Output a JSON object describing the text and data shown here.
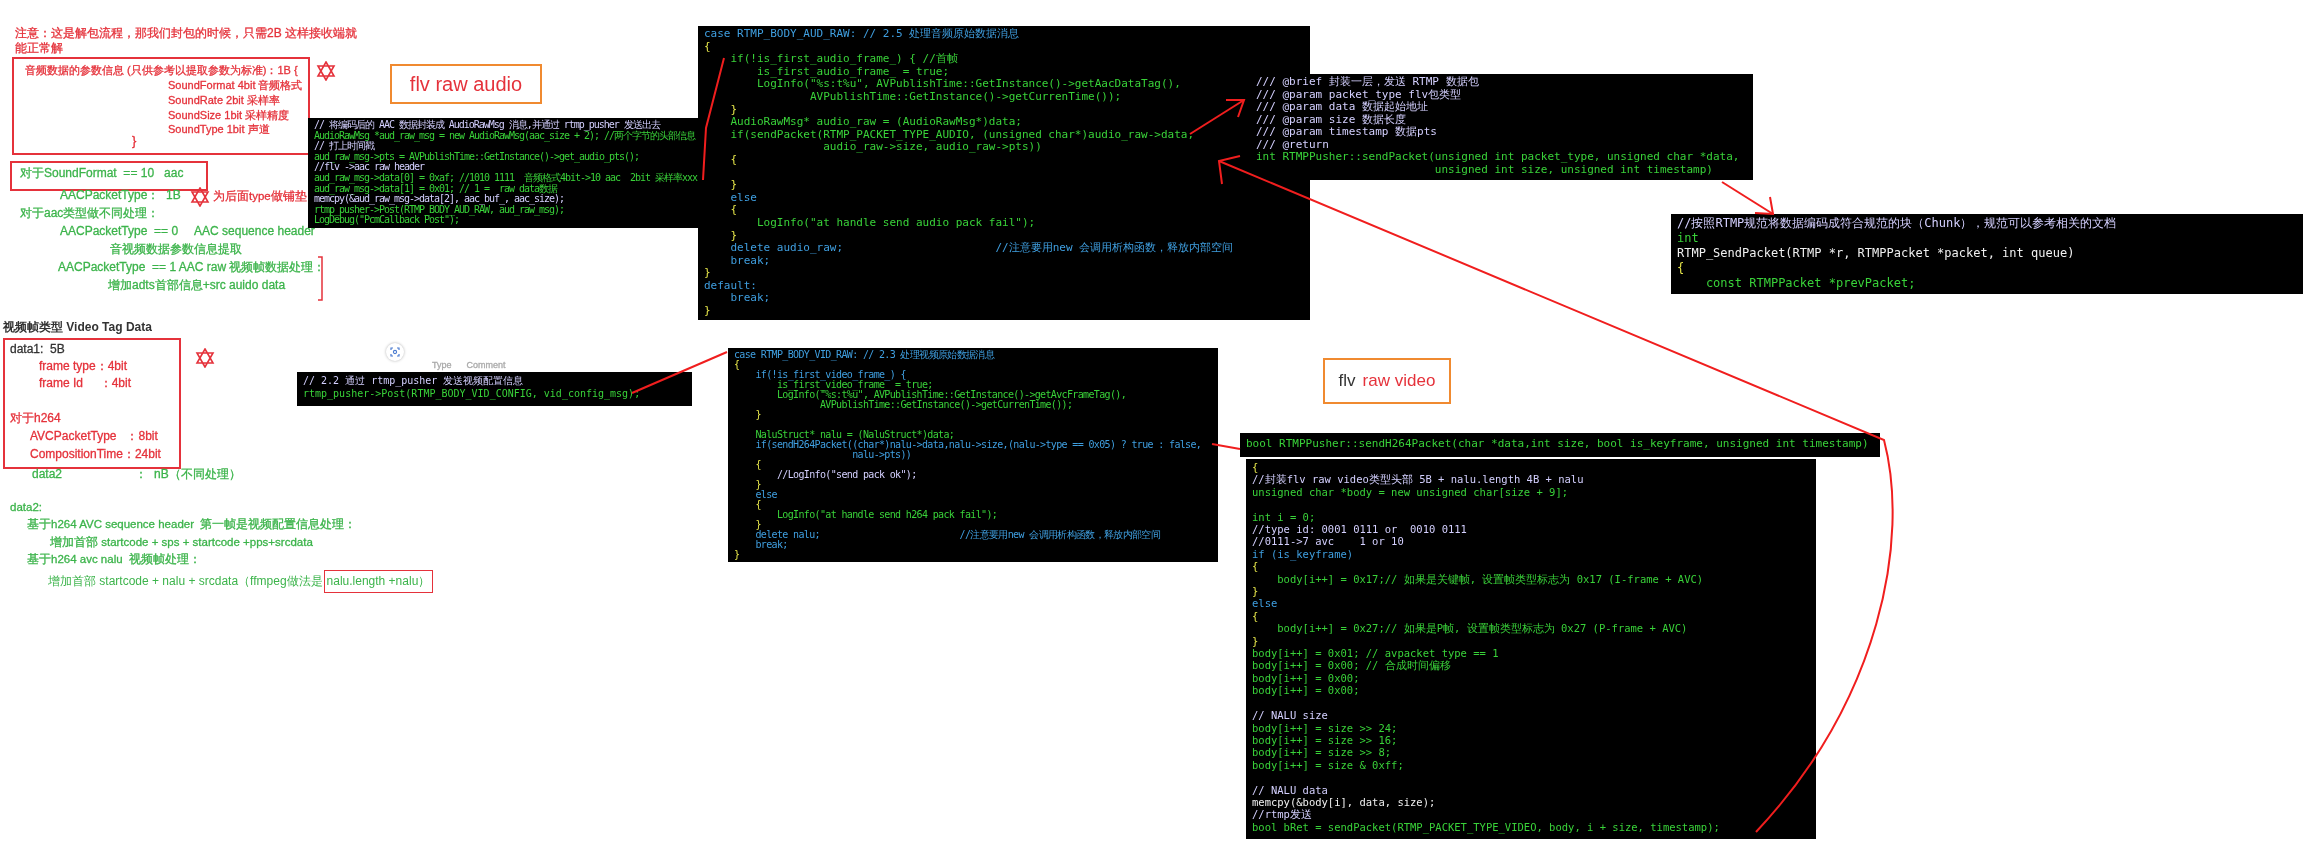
{
  "notes": [
    {
      "text": "注意：这是解包流程，那我们封包的时候，只需2B 这样接收端就能正常解",
      "color": "#e5323b"
    },
    {
      "text": "音频数据的参数信息 (只供参考以提取参数为标准)：1B {",
      "color": "#e5323b"
    },
    {
      "text": "SoundFormat 4bit 音频格式",
      "color": "#e5323b"
    },
    {
      "text": "SoundRate 2bit 采样率",
      "color": "#e5323b"
    },
    {
      "text": "SoundSize 1bit 采样精度",
      "color": "#e5323b"
    },
    {
      "text": "SoundType 1bit 声道",
      "color": "#e5323b"
    },
    {
      "text": "}",
      "color": "#e5323b"
    },
    {
      "text": "对于SoundFormat  == 10   aac",
      "color": "#3cb44b"
    },
    {
      "text": "AACPacketType：  1B",
      "color": "#3cb44b"
    },
    {
      "text": "为后面type做铺垫",
      "color": "#e5323b"
    },
    {
      "text": "对于aac类型做不同处理：",
      "color": "#3cb44b"
    },
    {
      "text": "AACPacketType  == 0     AAC sequence header",
      "color": "#3cb44b"
    },
    {
      "text": "音视频数据参数信息提取",
      "color": "#3cb44b"
    },
    {
      "text": "AACPacketType  == 1 AAC raw 视频帧数据处理：",
      "color": "#3cb44b"
    },
    {
      "text": "增加adts首部信息+src auido data",
      "color": "#3cb44b"
    },
    {
      "text": "data1:  5B",
      "color": "#333333"
    },
    {
      "text": "frame type：4bit",
      "color": "#e5323b"
    },
    {
      "text": "frame Id     ：4bit",
      "color": "#e5323b"
    },
    {
      "text": "对于h264",
      "color": "#e5323b"
    },
    {
      "text": "AVCPacketType   ：8bit",
      "color": "#e5323b"
    },
    {
      "text": "CompositionTime：24bit",
      "color": "#e5323b"
    },
    {
      "text": "data2                      ：  nB（不同处理）",
      "color": "#3cb44b"
    },
    {
      "text": "data2:",
      "color": "#3cb44b"
    },
    {
      "text": "基于h264 AVC sequence header  第一帧是视频配置信息处理：",
      "color": "#3cb44b"
    },
    {
      "text": "增加首部 startcode + sps + startcode +pps+srcdata",
      "color": "#3cb44b"
    },
    {
      "text": "基于h264 avc nalu  视频帧处理：",
      "color": "#3cb44b"
    },
    {
      "text": "增加首部 startcode + nalu + srcdata（ffmpeg做法是",
      "color": "#3cb44b",
      "highlight": "nalu.length +nalu）"
    },
    {
      "text": "Type      Comment",
      "color": "#aaaaaa"
    }
  ],
  "section_title": "视频帧类型 Video Tag Data",
  "labels": [
    {
      "parts": [
        {
          "text": "flv raw audio",
          "color": "#e5323b"
        }
      ]
    },
    {
      "parts": [
        {
          "text": "flv",
          "color": "#333333"
        },
        {
          "text": "raw video",
          "color": "#e5323b"
        }
      ]
    }
  ],
  "code_snippets": [
    {
      "lines": [
        {
          "text": "// 将编码后的 AAC 数据封装成 AudioRawMsg 消息,并通过 rtmp_pusher 发送出去",
          "kind": "comment"
        },
        {
          "text": "AudioRawMsg *aud_raw_msg = new AudioRawMsg(aac_size + 2); //两个字节的头部信息",
          "kind": "code"
        },
        {
          "text": "// 打上时间戳",
          "kind": "comment"
        },
        {
          "text": "aud_raw_msg->pts = AVPublishTime::GetInstance()->get_audio_pts();",
          "kind": "code"
        },
        {
          "text": "//flv ->aac raw header",
          "kind": "comment"
        },
        {
          "text": "aud_raw_msg->data[0] = 0xaf; //1010 1111  音频格式4bit->10 aac  2bit 采样率xxx",
          "kind": "code"
        },
        {
          "text": "aud_raw_msg->data[1] = 0x01; // 1 =  raw data数据",
          "kind": "code"
        },
        {
          "text": "memcpy(&aud_raw_msg->data[2], aac_buf_, aac_size);",
          "kind": "comment"
        },
        {
          "text": "rtmp_pusher->Post(RTMP_BODY_AUD_RAW, aud_raw_msg);",
          "kind": "code"
        },
        {
          "text": "LogDebug(\"PcmCallback Post\");",
          "kind": "code"
        }
      ]
    },
    {
      "lines": [
        {
          "text": "case RTMP_BODY_AUD_RAW: // 2.5 处理音频原始数据消息",
          "kind": "keyword"
        },
        {
          "text": "{",
          "kind": "brace"
        },
        {
          "text": "    if(!is_first_audio_frame_) { //首帧",
          "kind": "code"
        },
        {
          "text": "        is_first_audio_frame_ = true;",
          "kind": "code"
        },
        {
          "text": "        LogInfo(\"%s:t%u\", AVPublishTime::GetInstance()->getAacDataTag(),",
          "kind": "code"
        },
        {
          "text": "                AVPublishTime::GetInstance()->getCurrenTime());",
          "kind": "code"
        },
        {
          "text": "    }",
          "kind": "brace"
        },
        {
          "text": "    AudioRawMsg* audio_raw = (AudioRawMsg*)data;",
          "kind": "code"
        },
        {
          "text": "    if(sendPacket(RTMP_PACKET_TYPE_AUDIO, (unsigned char*)audio_raw->data,",
          "kind": "code"
        },
        {
          "text": "                  audio_raw->size, audio_raw->pts))",
          "kind": "code"
        },
        {
          "text": "    {",
          "kind": "brace"
        },
        {
          "kind": "blank"
        },
        {
          "text": "    }",
          "kind": "brace"
        },
        {
          "text": "    else",
          "kind": "keyword"
        },
        {
          "text": "    {",
          "kind": "brace"
        },
        {
          "text": "        LogInfo(\"at handle send audio pack fail\");",
          "kind": "code"
        },
        {
          "text": "    }",
          "kind": "brace"
        },
        {
          "text": "    delete audio_raw;                       //注意要用new 会调用析构函数，释放内部空间",
          "kind": "keyword"
        },
        {
          "text": "    break;",
          "kind": "keyword"
        },
        {
          "text": "}",
          "kind": "brace"
        },
        {
          "text": "default:",
          "kind": "keyword"
        },
        {
          "text": "    break;",
          "kind": "keyword"
        },
        {
          "text": "}",
          "kind": "brace"
        }
      ]
    },
    {
      "lines": [
        {
          "text": "/// @brief 封装一层，发送 RTMP 数据包",
          "kind": "comment"
        },
        {
          "text": "/// @param packet_type flv包类型",
          "kind": "comment"
        },
        {
          "text": "/// @param data 数据起始地址",
          "kind": "comment"
        },
        {
          "text": "/// @param size 数据长度",
          "kind": "comment"
        },
        {
          "text": "/// @param timestamp 数据pts",
          "kind": "comment"
        },
        {
          "text": "/// @return",
          "kind": "comment"
        },
        {
          "text": "int RTMPPusher::sendPacket(unsigned int packet_type, unsigned char *data,",
          "kind": "code"
        },
        {
          "text": "                           unsigned int size, unsigned int timestamp)",
          "kind": "code"
        }
      ]
    },
    {
      "lines": [
        {
          "text": "//按照RTMP规范将数据编码成符合规范的块（Chunk），规范可以参考相关的文档",
          "kind": "comment"
        },
        {
          "text": "int",
          "kind": "code"
        },
        {
          "text": "RTMP_SendPacket(RTMP *r, RTMPPacket *packet, int queue)",
          "kind": "plain"
        },
        {
          "text": "{",
          "kind": "brace"
        },
        {
          "text": "    const RTMPPacket *prevPacket;",
          "kind": "code"
        }
      ]
    },
    {
      "lines": [
        {
          "text": "// 2.2 通过 rtmp_pusher 发送视频配置信息",
          "kind": "comment"
        },
        {
          "text": "rtmp_pusher->Post(RTMP_BODY_VID_CONFIG, vid_config_msg);",
          "kind": "code"
        }
      ]
    },
    {
      "lines": [
        {
          "text": "case RTMP_BODY_VID_RAW: // 2.3 处理视频原始数据消息",
          "kind": "keyword"
        },
        {
          "text": "{",
          "kind": "brace"
        },
        {
          "text": "    if(!is_first_video_frame_) {",
          "kind": "keyword"
        },
        {
          "text": "        is_first_video_frame_ = true;",
          "kind": "code"
        },
        {
          "text": "        LogInfo(\"%s:t%u\", AVPublishTime::GetInstance()->getAvcFrameTag(),",
          "kind": "code"
        },
        {
          "text": "                AVPublishTime::GetInstance()->getCurrenTime());",
          "kind": "code"
        },
        {
          "text": "    }",
          "kind": "brace"
        },
        {
          "kind": "blank"
        },
        {
          "text": "    NaluStruct* nalu = (NaluStruct*)data;",
          "kind": "code"
        },
        {
          "text": "    if(sendH264Packet((char*)nalu->data,nalu->size,(nalu->type == 0x05) ? true : false,",
          "kind": "keyword"
        },
        {
          "text": "                      nalu->pts))",
          "kind": "keyword"
        },
        {
          "text": "    {",
          "kind": "brace"
        },
        {
          "text": "        //LogInfo(\"send pack ok\");",
          "kind": "comment"
        },
        {
          "text": "    }",
          "kind": "brace"
        },
        {
          "text": "    else",
          "kind": "keyword"
        },
        {
          "text": "    {",
          "kind": "brace"
        },
        {
          "text": "        LogInfo(\"at handle send h264 pack fail\");",
          "kind": "code"
        },
        {
          "text": "    }",
          "kind": "brace"
        },
        {
          "text": "    delete nalu;                          //注意要用new 会调用析构函数，释放内部空间",
          "kind": "keyword"
        },
        {
          "text": "    break;",
          "kind": "keyword"
        },
        {
          "text": "}",
          "kind": "brace"
        }
      ]
    },
    {
      "lines": [
        {
          "text": "bool RTMPPusher::sendH264Packet(char *data,int size, bool is_keyframe, unsigned int timestamp)",
          "kind": "code"
        }
      ]
    },
    {
      "lines": [
        {
          "text": "{",
          "kind": "brace"
        },
        {
          "text": "//封装flv raw video类型头部 5B + nalu.length 4B + nalu",
          "kind": "comment"
        },
        {
          "text": "unsigned char *body = new unsigned char[size + 9];",
          "kind": "code"
        },
        {
          "kind": "blank"
        },
        {
          "text": "int i = 0;",
          "kind": "code"
        },
        {
          "text": "//type id: 0001 0111 or  0010 0111",
          "kind": "comment"
        },
        {
          "text": "//0111->7 avc    1 or 10",
          "kind": "comment"
        },
        {
          "text": "if (is_keyframe)",
          "kind": "keyword"
        },
        {
          "text": "{",
          "kind": "brace"
        },
        {
          "text": "    body[i++] = 0x17;// 如果是关键帧, 设置帧类型标志为 0x17 (I-frame + AVC)",
          "kind": "code"
        },
        {
          "text": "}",
          "kind": "brace"
        },
        {
          "text": "else",
          "kind": "keyword"
        },
        {
          "text": "{",
          "kind": "brace"
        },
        {
          "text": "    body[i++] = 0x27;// 如果是P帧, 设置帧类型标志为 0x27 (P-frame + AVC)",
          "kind": "code"
        },
        {
          "text": "}",
          "kind": "brace"
        },
        {
          "text": "body[i++] = 0x01; // avpacket type == 1",
          "kind": "code"
        },
        {
          "text": "body[i++] = 0x00; // 合成时间偏移",
          "kind": "code"
        },
        {
          "text": "body[i++] = 0x00;",
          "kind": "code"
        },
        {
          "text": "body[i++] = 0x00;",
          "kind": "code"
        },
        {
          "kind": "blank"
        },
        {
          "text": "// NALU size",
          "kind": "comment"
        },
        {
          "text": "body[i++] = size >> 24;",
          "kind": "code"
        },
        {
          "text": "body[i++] = size >> 16;",
          "kind": "code"
        },
        {
          "text": "body[i++] = size >> 8;",
          "kind": "code"
        },
        {
          "text": "body[i++] = size & 0xff;",
          "kind": "code"
        },
        {
          "kind": "blank"
        },
        {
          "text": "// NALU data",
          "kind": "comment"
        },
        {
          "text": "memcpy(&body[i], data, size);",
          "kind": "plain"
        },
        {
          "text": "//rtmp发送",
          "kind": "comment"
        },
        {
          "text": "bool bRet = sendPacket(RTMP_PACKET_TYPE_VIDEO, body, i + size, timestamp);",
          "kind": "code"
        }
      ]
    }
  ]
}
